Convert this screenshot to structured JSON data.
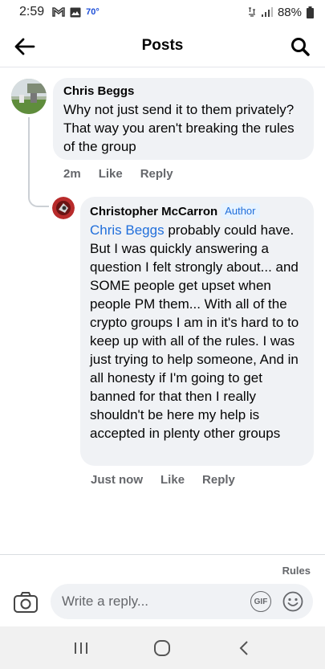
{
  "status_bar": {
    "time": "2:59",
    "temperature": "70°",
    "battery": "88%"
  },
  "header": {
    "title": "Posts"
  },
  "comments": [
    {
      "author": "Chris Beggs",
      "text": "Why not just send it to them privately? That way you aren't breaking the rules of the group",
      "time": "2m",
      "like_label": "Like",
      "reply_label": "Reply"
    },
    {
      "author": "Christopher McCarron",
      "badge": "Author",
      "mention": "Chris Beggs",
      "text": " probably could have. But I was quickly answering a question I felt strongly about... and SOME people get upset when people PM them...  With all of the crypto groups I am in it's hard to to keep up with all of the rules.  I was just trying to help someone, And in all honesty if I'm going to get banned for that then I really shouldn't be here my help is accepted in plenty other groups",
      "time": "Just now",
      "like_label": "Like",
      "reply_label": "Reply"
    }
  ],
  "reply_bar": {
    "rules_label": "Rules",
    "placeholder": "Write a reply...",
    "gif_label": "GIF"
  },
  "colors": {
    "bubble": "#f0f2f5",
    "link": "#216fdb",
    "meta": "#65676b"
  }
}
